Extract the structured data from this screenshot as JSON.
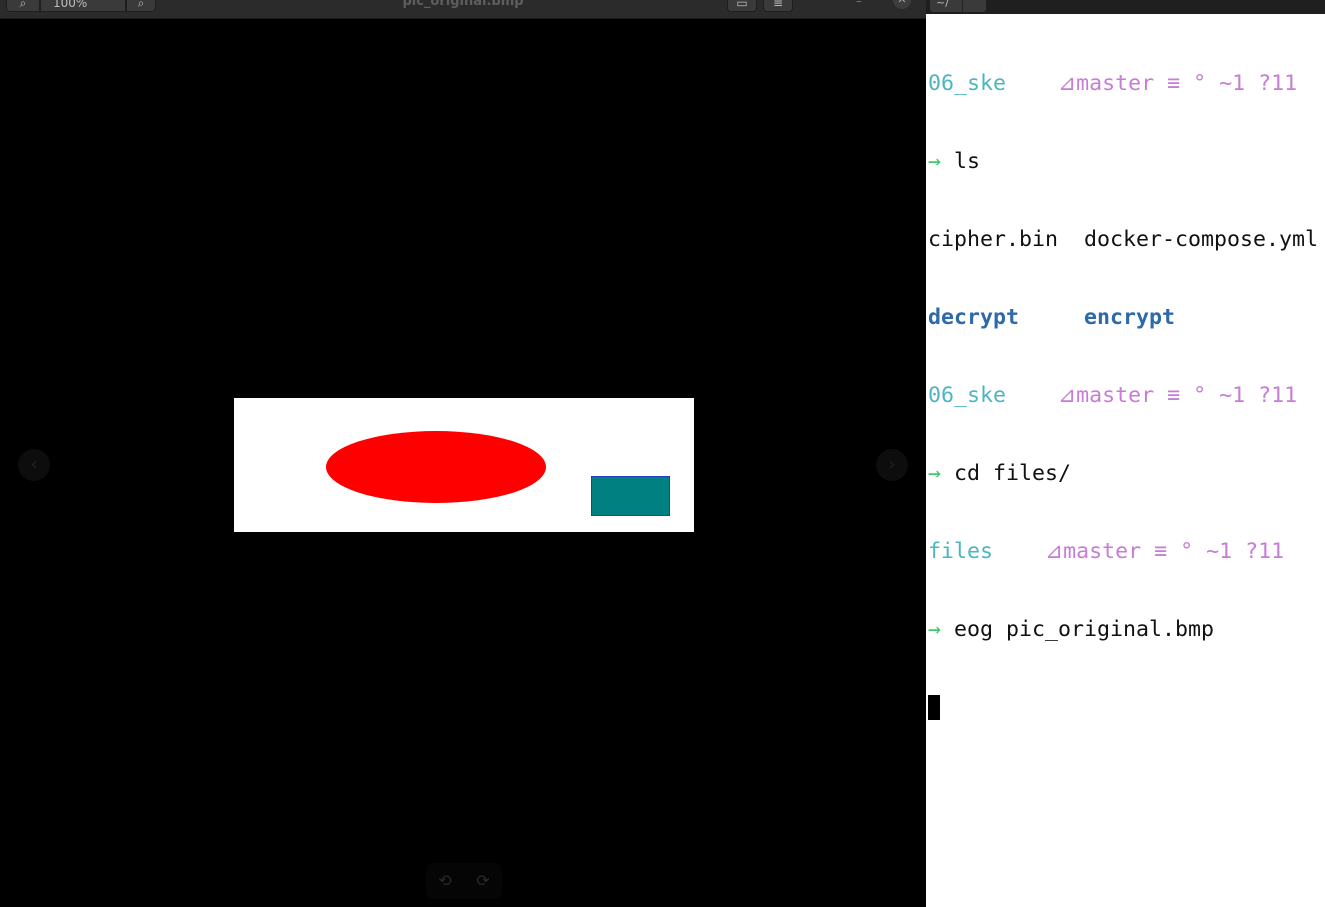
{
  "viewer": {
    "title": "pic_original.bmp",
    "zoom_value": "100%",
    "zoom_out_glyph": "⌕",
    "zoom_in_glyph": "⌕",
    "minimize_glyph": "–",
    "close_glyph": "✕",
    "prev_glyph": "‹",
    "next_glyph": "›",
    "rotate_left_glyph": "⟲",
    "rotate_right_glyph": "⟳",
    "icons": {
      "zoom_out": "zoom-out-icon",
      "zoom_in": "zoom-in-icon",
      "gallery": "gallery-icon",
      "menu": "menu-icon",
      "rotate_left": "rotate-left-icon",
      "rotate_right": "rotate-right-icon"
    },
    "image": {
      "background": "#ffffff",
      "ellipse_color": "#ff0000",
      "rect_fill": "#008080",
      "rect_stroke": "#1f3fbf"
    }
  },
  "terminal": {
    "tab_label": "~/",
    "lines": [
      {
        "type": "prompt",
        "dir": "06_ske",
        "git": "⊿master ≡ ° ~1 ?11"
      },
      {
        "type": "command",
        "arrow": "→",
        "cmd": "ls"
      },
      {
        "type": "output",
        "items": [
          "cipher.bin",
          "docker-compose.yml"
        ]
      },
      {
        "type": "output_exec",
        "items": [
          "decrypt",
          "encrypt"
        ]
      },
      {
        "type": "prompt",
        "dir": "06_ske",
        "git": "⊿master ≡ ° ~1 ?11"
      },
      {
        "type": "command",
        "arrow": "→",
        "cmd": "cd files/"
      },
      {
        "type": "prompt",
        "dir": "files",
        "git": "⊿master ≡ ° ~1 ?11"
      },
      {
        "type": "command",
        "arrow": "→",
        "cmd": "eog pic_original.bmp"
      }
    ],
    "colors": {
      "dir": "#4cb5c1",
      "git": "#c77dd6",
      "arrow": "#3ec96d",
      "exec": "#2e6aa8"
    }
  }
}
